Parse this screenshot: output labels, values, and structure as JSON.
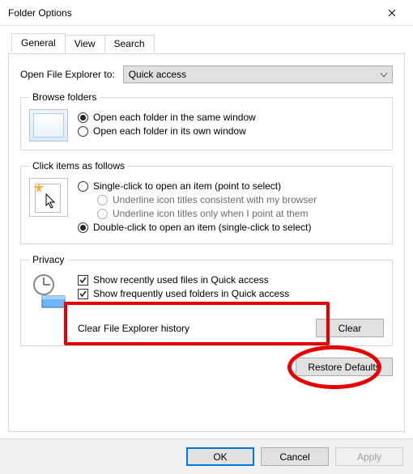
{
  "window": {
    "title": "Folder Options"
  },
  "tabs": {
    "general": "General",
    "view": "View",
    "search": "Search"
  },
  "open_to": {
    "label": "Open File Explorer to:",
    "value": "Quick access"
  },
  "browse": {
    "legend": "Browse folders",
    "same": "Open each folder in the same window",
    "own": "Open each folder in its own window"
  },
  "click": {
    "legend": "Click items as follows",
    "single": "Single-click to open an item (point to select)",
    "underline_browser": "Underline icon titles consistent with my browser",
    "underline_point": "Underline icon titles only when I point at them",
    "double": "Double-click to open an item (single-click to select)"
  },
  "privacy": {
    "legend": "Privacy",
    "recent": "Show recently used files in Quick access",
    "frequent": "Show frequently used folders in Quick access",
    "clear_label": "Clear File Explorer history",
    "clear_btn": "Clear"
  },
  "buttons": {
    "restore": "Restore Defaults",
    "ok": "OK",
    "cancel": "Cancel",
    "apply": "Apply"
  }
}
